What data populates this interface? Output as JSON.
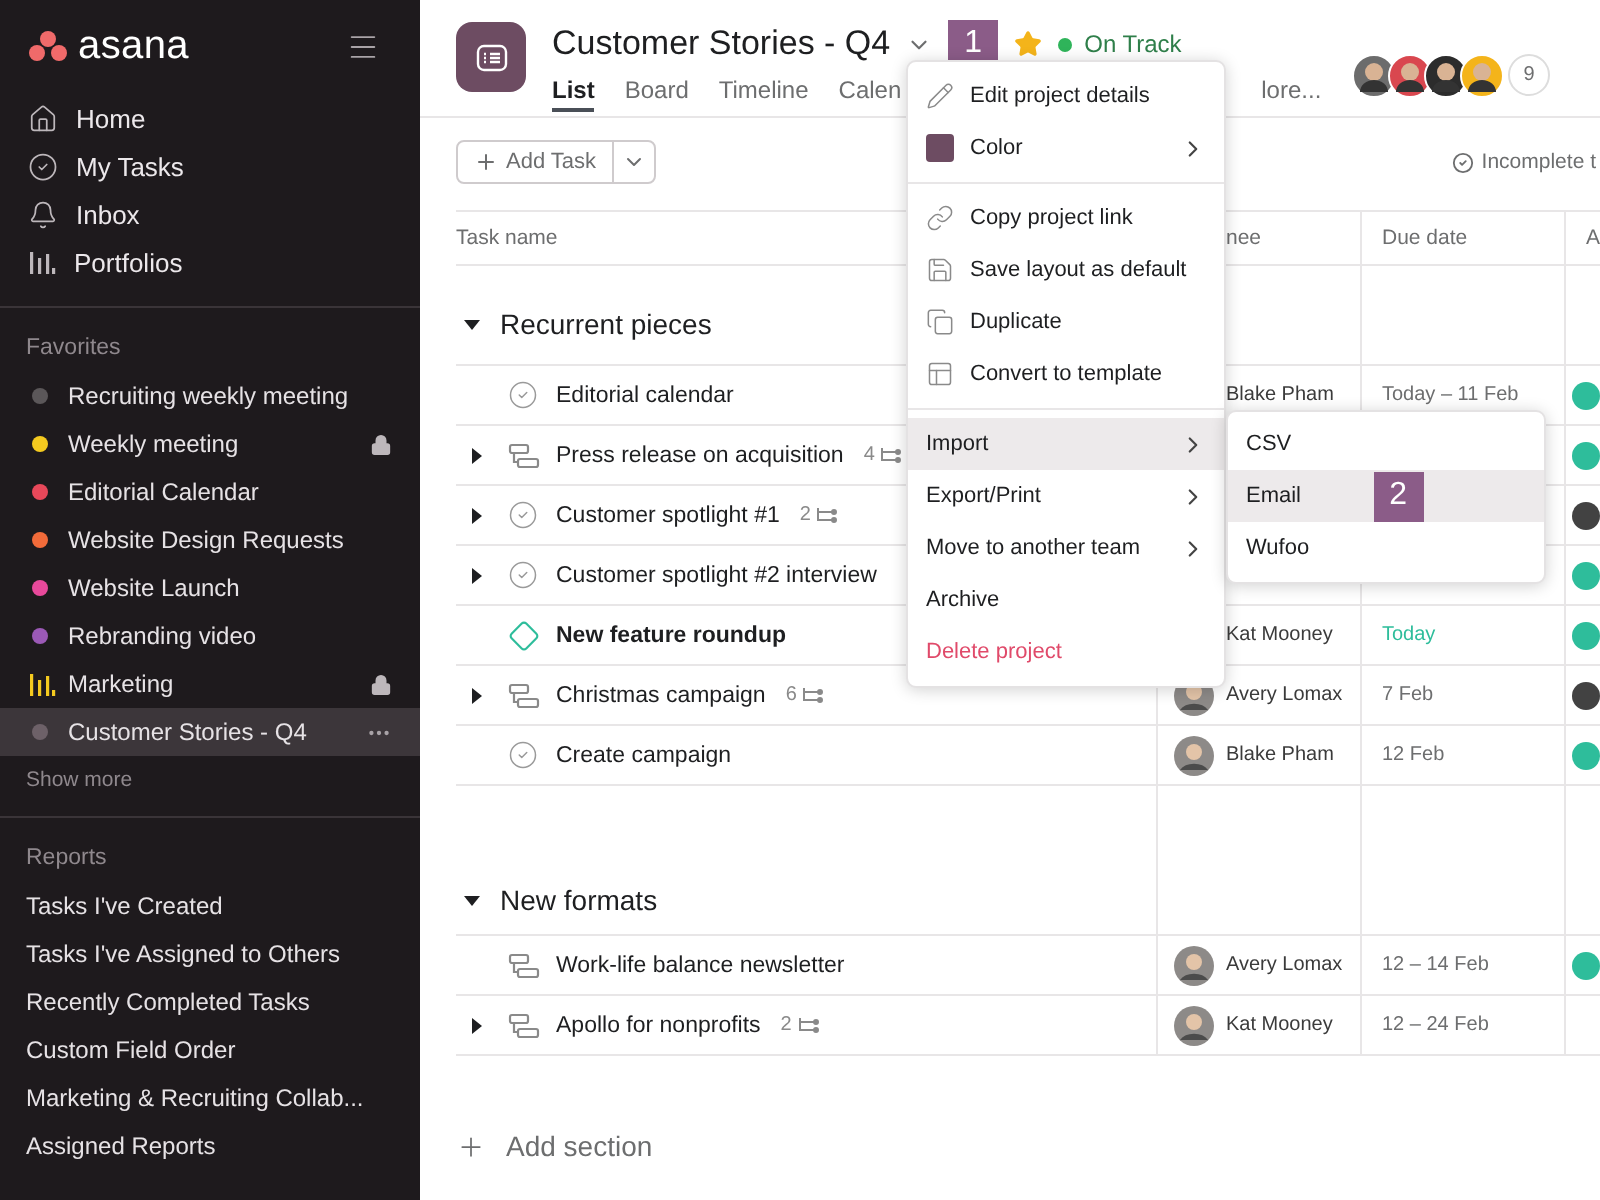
{
  "sidebar": {
    "logo": "asana",
    "nav": [
      {
        "label": "Home",
        "kind": "home"
      },
      {
        "label": "My Tasks",
        "kind": "tasks"
      },
      {
        "label": "Inbox",
        "kind": "inbox"
      },
      {
        "label": "Portfolios",
        "kind": "portfolios"
      }
    ],
    "favorites": {
      "title": "Favorites",
      "items": [
        {
          "label": "Recruiting weekly meeting",
          "kind": "dot",
          "color": "#5b5759",
          "locked": false,
          "selected": false
        },
        {
          "label": "Weekly meeting",
          "kind": "dot",
          "color": "#f4ca1f",
          "locked": true,
          "selected": false
        },
        {
          "label": "Editorial Calendar",
          "kind": "dot",
          "color": "#e8485a",
          "locked": false,
          "selected": false
        },
        {
          "label": "Website Design Requests",
          "kind": "dot",
          "color": "#f26b3a",
          "locked": false,
          "selected": false
        },
        {
          "label": "Website Launch",
          "kind": "dot",
          "color": "#e8499b",
          "locked": false,
          "selected": false
        },
        {
          "label": "Rebranding video",
          "kind": "dot",
          "color": "#9b59b6",
          "locked": false,
          "selected": false
        },
        {
          "label": "Marketing",
          "kind": "chart",
          "color": "#f4ca1f",
          "locked": true,
          "selected": false
        },
        {
          "label": "Customer Stories - Q4",
          "kind": "dot",
          "color": "#6d6168",
          "locked": false,
          "selected": true
        }
      ],
      "show_more": "Show more"
    },
    "reports": {
      "title": "Reports",
      "items": [
        "Tasks I've Created",
        "Tasks I've Assigned to Others",
        "Recently Completed Tasks",
        "Custom Field Order",
        "Marketing & Recruiting Collab...",
        "Assigned Reports"
      ]
    }
  },
  "project": {
    "title": "Customer Stories - Q4",
    "callout": "1",
    "starred": true,
    "status": "On Track",
    "tabs": [
      {
        "label": "List",
        "selected": true
      },
      {
        "label": "Board",
        "selected": false
      },
      {
        "label": "Timeline",
        "selected": false
      },
      {
        "label": "Calen",
        "selected": false
      },
      {
        "label": "lore...",
        "selected": false
      }
    ],
    "members": "9"
  },
  "toolbar": {
    "add_task": "Add Task",
    "filter": "Incomplete t"
  },
  "table": {
    "columns": [
      "Task name",
      "nee",
      "Due date",
      "A"
    ],
    "sections": [
      {
        "title": "Recurrent pieces",
        "expanded": true,
        "rows": [
          {
            "kind": "task",
            "name": "Editorial calendar",
            "expandable": false,
            "assignee": "Blake Pham",
            "avatar": false,
            "due": "Today – 11 Feb",
            "due_today": false,
            "color": "#2ebd9b"
          },
          {
            "kind": "approval",
            "name": "Press release on acquisition",
            "expandable": true,
            "subtasks": "4",
            "color": "#2ebd9b"
          },
          {
            "kind": "task",
            "name": "Customer spotlight #1",
            "expandable": true,
            "subtasks": "2",
            "color": "#424242"
          },
          {
            "kind": "task",
            "name": "Customer spotlight #2 interview",
            "expandable": true,
            "color": "#2ebd9b"
          },
          {
            "kind": "milestone",
            "name": "New feature roundup",
            "expandable": false,
            "assignee": "Kat Mooney",
            "avatar": false,
            "due": "Today",
            "due_today": true,
            "color": "#2ebd9b"
          },
          {
            "kind": "approval",
            "name": "Christmas campaign",
            "expandable": true,
            "subtasks": "6",
            "assignee": "Avery Lomax",
            "avatar": true,
            "due": "7 Feb",
            "due_today": false,
            "color": "#424242"
          },
          {
            "kind": "task",
            "name": "Create campaign",
            "expandable": false,
            "assignee": "Blake Pham",
            "avatar": true,
            "due": "12 Feb",
            "due_today": false,
            "color": "#2ebd9b"
          }
        ]
      },
      {
        "title": "New formats",
        "expanded": true,
        "rows": [
          {
            "kind": "approval",
            "name": "Work-life balance newsletter",
            "expandable": false,
            "assignee": "Avery Lomax",
            "avatar": true,
            "due": "12 – 14 Feb",
            "due_today": false,
            "color": "#2ebd9b"
          },
          {
            "kind": "approval",
            "name": "Apollo for nonprofits",
            "expandable": true,
            "subtasks": "2",
            "assignee": "Kat Mooney",
            "avatar": true,
            "due": "12 – 24 Feb",
            "due_today": false
          }
        ]
      }
    ],
    "add_section": "Add section"
  },
  "menu": {
    "items": [
      {
        "kind": "edit",
        "label": "Edit project details",
        "submenu": false,
        "highlighted": false
      },
      {
        "kind": "color",
        "label": "Color",
        "submenu": true,
        "highlighted": false
      },
      {
        "kind": "divider"
      },
      {
        "kind": "link",
        "label": "Copy project link",
        "submenu": false,
        "highlighted": false
      },
      {
        "kind": "save",
        "label": "Save layout as default",
        "submenu": false,
        "highlighted": false
      },
      {
        "kind": "duplicate",
        "label": "Duplicate",
        "submenu": false,
        "highlighted": false
      },
      {
        "kind": "template",
        "label": "Convert to template",
        "submenu": false,
        "highlighted": false
      },
      {
        "kind": "divider"
      },
      {
        "kind": "plain",
        "label": "Import",
        "submenu": true,
        "highlighted": true
      },
      {
        "kind": "plain",
        "label": "Export/Print",
        "submenu": true,
        "highlighted": false
      },
      {
        "kind": "plain",
        "label": "Move to another team",
        "submenu": true,
        "highlighted": false
      },
      {
        "kind": "plain",
        "label": "Archive",
        "submenu": false,
        "highlighted": false
      },
      {
        "kind": "danger",
        "label": "Delete project",
        "submenu": false,
        "highlighted": false
      }
    ],
    "submenu": [
      {
        "label": "CSV",
        "highlighted": false
      },
      {
        "label": "Email",
        "highlighted": true,
        "callout": "2"
      },
      {
        "label": "Wufoo",
        "highlighted": false
      }
    ]
  }
}
